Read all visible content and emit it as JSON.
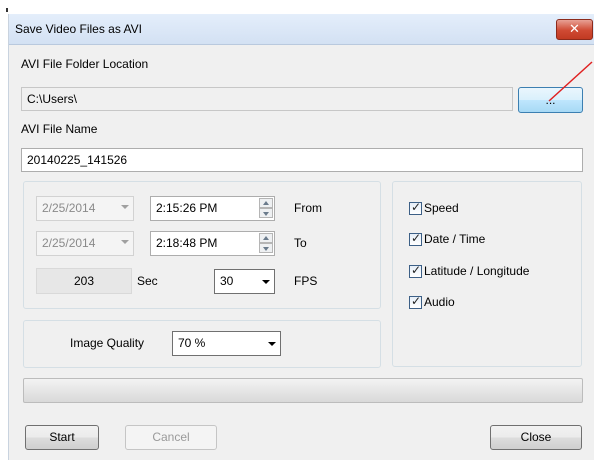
{
  "window": {
    "title": "Save Video Files as AVI",
    "close_glyph": "✕"
  },
  "folder": {
    "label": "AVI File Folder Location",
    "value": "C:\\Users\\",
    "browse_label": "..."
  },
  "filename": {
    "label": "AVI File Name",
    "value": "20140225_141526"
  },
  "time_range": {
    "from_date": "2/25/2014",
    "from_time": "2:15:26 PM",
    "from_label": "From",
    "to_date": "2/25/2014",
    "to_time": "2:18:48 PM",
    "to_label": "To",
    "duration": "203",
    "duration_unit": "Sec",
    "fps_value": "30",
    "fps_label": "FPS"
  },
  "quality": {
    "label": "Image Quality",
    "value": "70 %"
  },
  "overlays": [
    {
      "label": "Speed",
      "checked": true
    },
    {
      "label": "Date / Time",
      "checked": true
    },
    {
      "label": "Latitude / Longitude",
      "checked": true
    },
    {
      "label": "Audio",
      "checked": true
    }
  ],
  "progress": {
    "fraction": 0
  },
  "buttons": {
    "start": "Start",
    "cancel": "Cancel",
    "close": "Close"
  },
  "colors": {
    "annotation_arrow": "#e02020",
    "close_button": "#c94a34"
  }
}
